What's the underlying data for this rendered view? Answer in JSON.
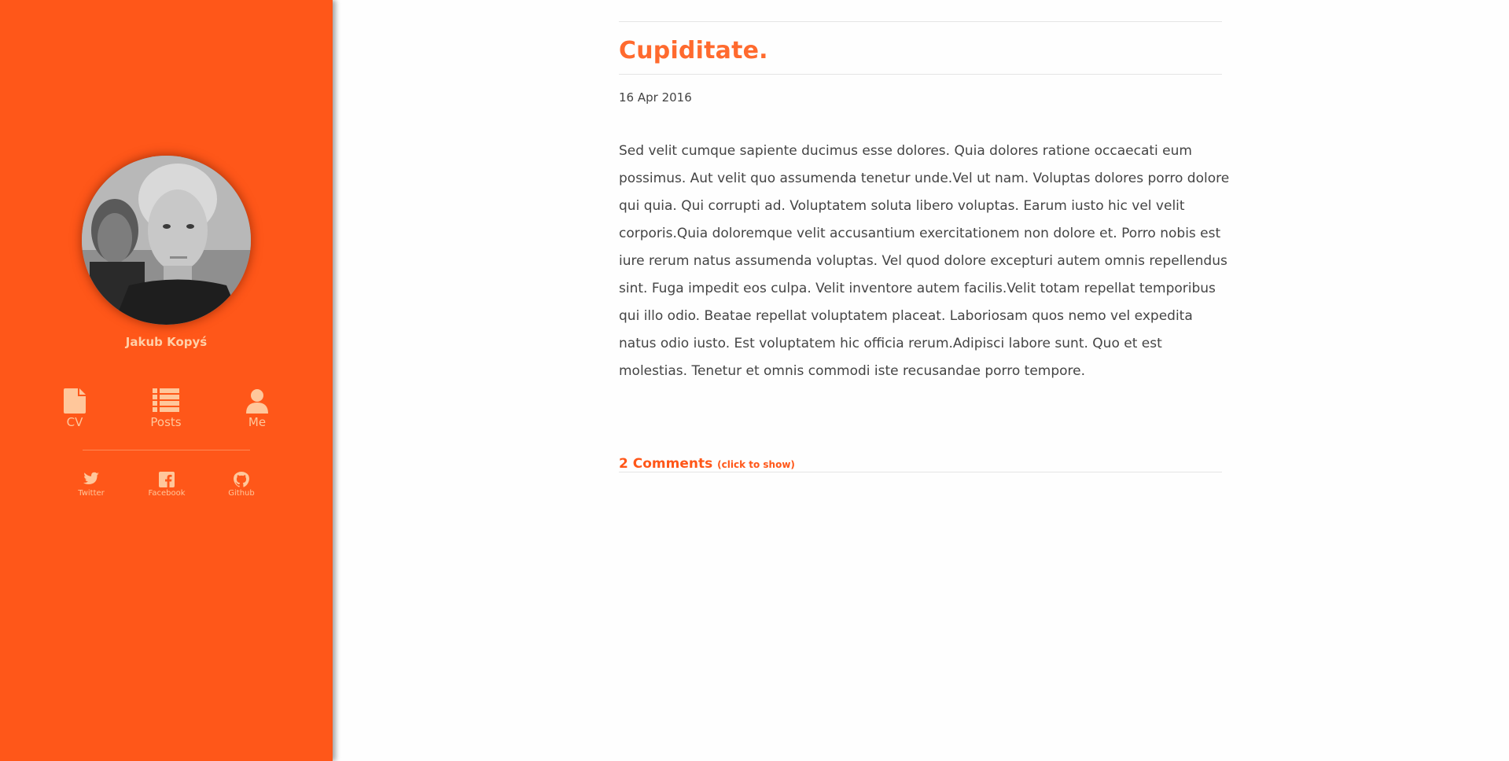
{
  "theme": {
    "accent": "#ff5719",
    "sidebar_text": "#ffc79b",
    "title_color": "#ff6a2e"
  },
  "sidebar": {
    "author_name": "Jakub Kopyś",
    "nav": [
      {
        "label": "CV",
        "icon": "file-icon"
      },
      {
        "label": "Posts",
        "icon": "list-icon"
      },
      {
        "label": "Me",
        "icon": "user-icon"
      }
    ],
    "social": [
      {
        "label": "Twitter",
        "icon": "twitter-icon"
      },
      {
        "label": "Facebook",
        "icon": "facebook-icon"
      },
      {
        "label": "Github",
        "icon": "github-icon"
      }
    ]
  },
  "post": {
    "title": "Cupiditate.",
    "date": "16 Apr 2016",
    "body": "Sed velit cumque sapiente ducimus esse dolores. Quia dolores ratione occaecati eum possimus. Aut velit quo assumenda tenetur unde.Vel ut nam. Voluptas dolores porro dolore qui quia. Qui corrupti ad. Voluptatem soluta libero voluptas. Earum iusto hic vel velit corporis.Quia doloremque velit accusantium exercitationem non dolore et. Porro nobis est iure rerum natus assumenda voluptas. Vel quod dolore excepturi autem omnis repellendus sint. Fuga impedit eos culpa. Velit inventore autem facilis.Velit totam repellat temporibus qui illo odio. Beatae repellat voluptatem placeat. Laboriosam quos nemo vel expedita natus odio iusto. Est voluptatem hic officia rerum.Adipisci labore sunt. Quo et est molestias. Tenetur et omnis commodi iste recusandae porro tempore.",
    "comments_label": "2 Comments",
    "comments_hint": "(click to show)"
  }
}
